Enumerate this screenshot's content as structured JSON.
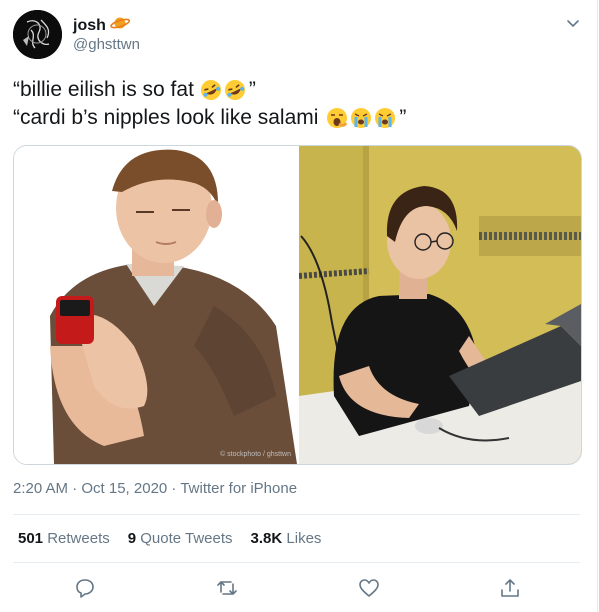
{
  "author": {
    "display_name": "josh",
    "handle": "@ghsttwn"
  },
  "tweet": {
    "line1": "“billie eilish is so fat",
    "line1_end": "”",
    "line2": "“cardi b’s nipples look like salami",
    "line2_end": "”"
  },
  "media": {
    "watermark": "© stockphoto / ghsttwn"
  },
  "meta": {
    "timestamp": "2:20 AM · Oct 15, 2020 · Twitter for iPhone"
  },
  "stats": [
    {
      "num": "501",
      "label": "Retweets"
    },
    {
      "num": "9",
      "label": "Quote Tweets"
    },
    {
      "num": "3.8K",
      "label": "Likes"
    }
  ],
  "icons": {
    "name_badge": "planet-emoji-icon",
    "line1_emojis": [
      "rofl-emoji-icon",
      "rofl-emoji-icon"
    ],
    "line2_emojis": [
      "yawning-emoji-icon",
      "crying-emoji-icon",
      "crying-emoji-icon"
    ],
    "actions": [
      "reply-icon",
      "retweet-icon",
      "like-icon",
      "share-icon"
    ]
  },
  "colors": {
    "text": "#14171a",
    "secondary": "#657786",
    "divider": "#e6ecf0"
  }
}
